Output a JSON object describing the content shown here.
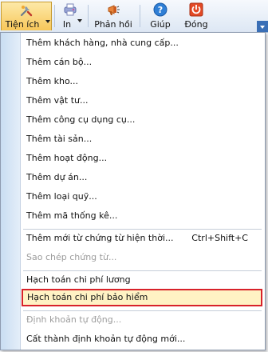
{
  "toolbar": {
    "buttons": [
      {
        "label": "Tiện ích",
        "icon": "tools-icon"
      },
      {
        "label": "In",
        "icon": "printer-icon"
      },
      {
        "label": "Phản hồi",
        "icon": "megaphone-icon"
      },
      {
        "label": "Giúp",
        "icon": "help-icon"
      },
      {
        "label": "Đóng",
        "icon": "close-icon"
      }
    ]
  },
  "menu": {
    "items": [
      {
        "label": "Thêm khách hàng, nhà cung cấp..."
      },
      {
        "label": "Thêm cán bộ..."
      },
      {
        "label": "Thêm kho..."
      },
      {
        "label": "Thêm vật tư..."
      },
      {
        "label": "Thêm công cụ dụng cụ..."
      },
      {
        "label": "Thêm tài sản..."
      },
      {
        "label": "Thêm hoạt động..."
      },
      {
        "label": "Thêm dự án..."
      },
      {
        "label": "Thêm loại quỹ..."
      },
      {
        "label": "Thêm mã thống kê..."
      },
      {
        "label": "Thêm mới từ chứng từ hiện thời...",
        "shortcut": "Ctrl+Shift+C"
      },
      {
        "label": "Sao chép chứng từ...",
        "disabled": true
      },
      {
        "label": "Hạch toán chi phí lương"
      },
      {
        "label": "Hạch toán chi phí bảo hiểm",
        "highlighted": true
      },
      {
        "label": "Định khoản tự động...",
        "disabled": true
      },
      {
        "label": "Cất thành định khoản tự động mới..."
      }
    ]
  },
  "colors": {
    "highlight_border": "#d8222a",
    "highlight_fill": "#fff2c4",
    "active_button": "#f7c75a",
    "disabled_text": "#9c9c9c"
  }
}
